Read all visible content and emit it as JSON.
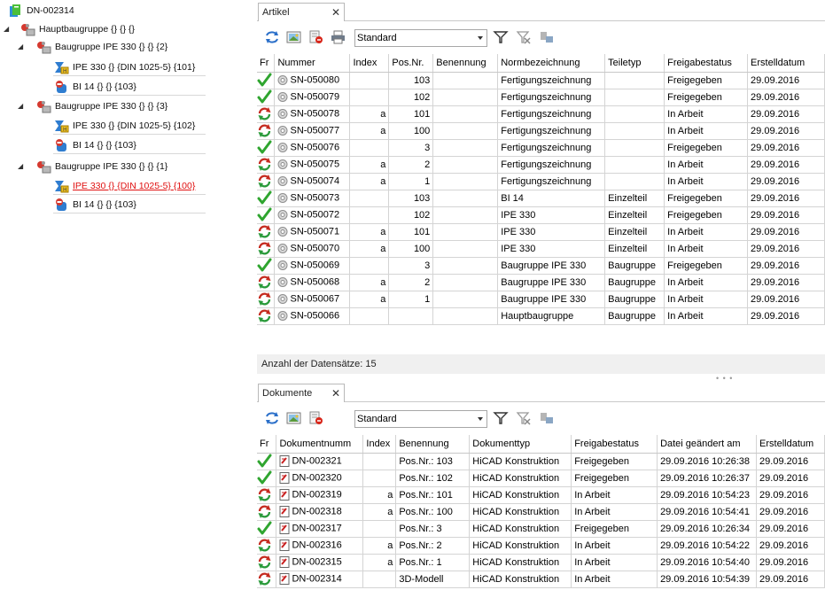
{
  "tree": {
    "root": {
      "label": "DN-002314",
      "icon": "document-folder-icon"
    },
    "nodes": [
      {
        "label": "Hauptbaugruppe {} {} {}",
        "icon": "assembly-icon",
        "expanded": true,
        "selected": false
      },
      {
        "label": "Baugruppe IPE 330 {} {} {2}",
        "icon": "assembly-icon",
        "expanded": true,
        "selected": false
      },
      {
        "label": "IPE 330 {} {DIN 1025-5} {101}",
        "icon": "beam-part-icon",
        "selected": false
      },
      {
        "label": "BI 14 {} {} {103}",
        "icon": "sheet-part-icon",
        "selected": false
      },
      {
        "label": "Baugruppe IPE 330 {} {} {3}",
        "icon": "assembly-icon",
        "expanded": true,
        "selected": false
      },
      {
        "label": "IPE 330 {} {DIN 1025-5} {102}",
        "icon": "beam-part-icon",
        "selected": false
      },
      {
        "label": "BI 14 {} {} {103}",
        "icon": "sheet-part-icon",
        "selected": false
      },
      {
        "label": "Baugruppe IPE 330 {} {} {1}",
        "icon": "assembly-icon",
        "expanded": true,
        "selected": false
      },
      {
        "label": "IPE 330 {} {DIN 1025-5} {100}",
        "icon": "beam-part-icon",
        "selected": true
      },
      {
        "label": "BI 14 {} {} {103}",
        "icon": "sheet-part-icon",
        "selected": false
      }
    ]
  },
  "artikel": {
    "tab_label": "Artikel",
    "close_symbol": "✕",
    "view_select": "Standard",
    "columns": [
      "Fr",
      "Nummer",
      "Index",
      "Pos.Nr.",
      "Benennung",
      "Normbezeichnung",
      "Teiletyp",
      "Freigabestatus",
      "Erstelldatum"
    ],
    "rows": [
      {
        "status": "released",
        "nummer": "SN-050080",
        "index": "",
        "pos": "103",
        "benennung": "",
        "norm": "Fertigungszeichnung",
        "typ": "",
        "freigabe": "Freigegeben",
        "datum": "29.09.2016"
      },
      {
        "status": "released",
        "nummer": "SN-050079",
        "index": "",
        "pos": "102",
        "benennung": "",
        "norm": "Fertigungszeichnung",
        "typ": "",
        "freigabe": "Freigegeben",
        "datum": "29.09.2016"
      },
      {
        "status": "work",
        "nummer": "SN-050078",
        "index": "a",
        "pos": "101",
        "benennung": "",
        "norm": "Fertigungszeichnung",
        "typ": "",
        "freigabe": "In Arbeit",
        "datum": "29.09.2016"
      },
      {
        "status": "work",
        "nummer": "SN-050077",
        "index": "a",
        "pos": "100",
        "benennung": "",
        "norm": "Fertigungszeichnung",
        "typ": "",
        "freigabe": "In Arbeit",
        "datum": "29.09.2016"
      },
      {
        "status": "released",
        "nummer": "SN-050076",
        "index": "",
        "pos": "3",
        "benennung": "",
        "norm": "Fertigungszeichnung",
        "typ": "",
        "freigabe": "Freigegeben",
        "datum": "29.09.2016"
      },
      {
        "status": "work",
        "nummer": "SN-050075",
        "index": "a",
        "pos": "2",
        "benennung": "",
        "norm": "Fertigungszeichnung",
        "typ": "",
        "freigabe": "In Arbeit",
        "datum": "29.09.2016"
      },
      {
        "status": "work",
        "nummer": "SN-050074",
        "index": "a",
        "pos": "1",
        "benennung": "",
        "norm": "Fertigungszeichnung",
        "typ": "",
        "freigabe": "In Arbeit",
        "datum": "29.09.2016"
      },
      {
        "status": "released",
        "nummer": "SN-050073",
        "index": "",
        "pos": "103",
        "benennung": "",
        "norm": "BI 14",
        "typ": "Einzelteil",
        "freigabe": "Freigegeben",
        "datum": "29.09.2016"
      },
      {
        "status": "released",
        "nummer": "SN-050072",
        "index": "",
        "pos": "102",
        "benennung": "",
        "norm": "IPE 330",
        "typ": "Einzelteil",
        "freigabe": "Freigegeben",
        "datum": "29.09.2016"
      },
      {
        "status": "work",
        "nummer": "SN-050071",
        "index": "a",
        "pos": "101",
        "benennung": "",
        "norm": "IPE 330",
        "typ": "Einzelteil",
        "freigabe": "In Arbeit",
        "datum": "29.09.2016"
      },
      {
        "status": "work",
        "nummer": "SN-050070",
        "index": "a",
        "pos": "100",
        "benennung": "",
        "norm": "IPE 330",
        "typ": "Einzelteil",
        "freigabe": "In Arbeit",
        "datum": "29.09.2016"
      },
      {
        "status": "released",
        "nummer": "SN-050069",
        "index": "",
        "pos": "3",
        "benennung": "",
        "norm": "Baugruppe IPE 330",
        "typ": "Baugruppe",
        "freigabe": "Freigegeben",
        "datum": "29.09.2016"
      },
      {
        "status": "work",
        "nummer": "SN-050068",
        "index": "a",
        "pos": "2",
        "benennung": "",
        "norm": "Baugruppe IPE 330",
        "typ": "Baugruppe",
        "freigabe": "In Arbeit",
        "datum": "29.09.2016"
      },
      {
        "status": "work",
        "nummer": "SN-050067",
        "index": "a",
        "pos": "1",
        "benennung": "",
        "norm": "Baugruppe IPE 330",
        "typ": "Baugruppe",
        "freigabe": "In Arbeit",
        "datum": "29.09.2016"
      },
      {
        "status": "work",
        "nummer": "SN-050066",
        "index": "",
        "pos": "",
        "benennung": "",
        "norm": "Hauptbaugruppe",
        "typ": "Baugruppe",
        "freigabe": "In Arbeit",
        "datum": "29.09.2016"
      }
    ],
    "record_count": "Anzahl der Datensätze: 15"
  },
  "dokumente": {
    "tab_label": "Dokumente",
    "close_symbol": "✕",
    "view_select": "Standard",
    "columns": [
      "Fr",
      "Dokumentnumm",
      "Index",
      "Benennung",
      "Dokumenttyp",
      "Freigabestatus",
      "Datei geändert am",
      "Erstelldatum"
    ],
    "rows": [
      {
        "status": "released",
        "nummer": "DN-002321",
        "index": "",
        "benennung": "Pos.Nr.: 103",
        "typ": "HiCAD Konstruktion",
        "freigabe": "Freigegeben",
        "geaendert": "29.09.2016 10:26:38",
        "datum": "29.09.2016"
      },
      {
        "status": "released",
        "nummer": "DN-002320",
        "index": "",
        "benennung": "Pos.Nr.: 102",
        "typ": "HiCAD Konstruktion",
        "freigabe": "Freigegeben",
        "geaendert": "29.09.2016 10:26:37",
        "datum": "29.09.2016"
      },
      {
        "status": "work",
        "nummer": "DN-002319",
        "index": "a",
        "benennung": "Pos.Nr.: 101",
        "typ": "HiCAD Konstruktion",
        "freigabe": "In Arbeit",
        "geaendert": "29.09.2016 10:54:23",
        "datum": "29.09.2016"
      },
      {
        "status": "work",
        "nummer": "DN-002318",
        "index": "a",
        "benennung": "Pos.Nr.: 100",
        "typ": "HiCAD Konstruktion",
        "freigabe": "In Arbeit",
        "geaendert": "29.09.2016 10:54:41",
        "datum": "29.09.2016"
      },
      {
        "status": "released",
        "nummer": "DN-002317",
        "index": "",
        "benennung": "Pos.Nr.: 3",
        "typ": "HiCAD Konstruktion",
        "freigabe": "Freigegeben",
        "geaendert": "29.09.2016 10:26:34",
        "datum": "29.09.2016"
      },
      {
        "status": "work",
        "nummer": "DN-002316",
        "index": "a",
        "benennung": "Pos.Nr.: 2",
        "typ": "HiCAD Konstruktion",
        "freigabe": "In Arbeit",
        "geaendert": "29.09.2016 10:54:22",
        "datum": "29.09.2016"
      },
      {
        "status": "work",
        "nummer": "DN-002315",
        "index": "a",
        "benennung": "Pos.Nr.: 1",
        "typ": "HiCAD Konstruktion",
        "freigabe": "In Arbeit",
        "geaendert": "29.09.2016 10:54:40",
        "datum": "29.09.2016"
      },
      {
        "status": "work",
        "nummer": "DN-002314",
        "index": "",
        "benennung": "3D-Modell",
        "typ": "HiCAD Konstruktion",
        "freigabe": "In Arbeit",
        "geaendert": "29.09.2016 10:54:39",
        "datum": "29.09.2016"
      }
    ]
  },
  "colors": {
    "selected_text": "#e01010",
    "check_green": "#2fa52f",
    "work_red": "#c52b1f",
    "work_green": "#2a9a3a"
  }
}
